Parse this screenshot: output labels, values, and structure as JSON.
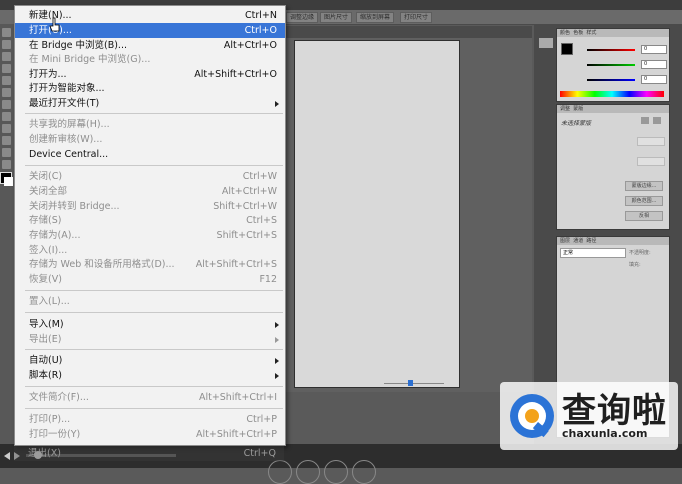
{
  "menu": {
    "items": [
      {
        "label": "新建(N)...",
        "shortcut": "Ctrl+N",
        "state": "normal"
      },
      {
        "label": "打开(O)...",
        "shortcut": "Ctrl+O",
        "state": "highlighted"
      },
      {
        "label": "在 Bridge 中浏览(B)...",
        "shortcut": "Alt+Ctrl+O",
        "state": "normal"
      },
      {
        "label": "在 Mini Bridge 中浏览(G)...",
        "shortcut": "",
        "state": "disabled"
      },
      {
        "label": "打开为...",
        "shortcut": "Alt+Shift+Ctrl+O",
        "state": "normal"
      },
      {
        "label": "打开为智能对象...",
        "shortcut": "",
        "state": "normal"
      },
      {
        "label": "最近打开文件(T)",
        "shortcut": "",
        "state": "submenu"
      },
      {
        "label": "共享我的屏幕(H)...",
        "shortcut": "",
        "state": "disabled"
      },
      {
        "label": "创建新审核(W)...",
        "shortcut": "",
        "state": "disabled"
      },
      {
        "label": "Device Central...",
        "shortcut": "",
        "state": "normal"
      },
      {
        "label": "关闭(C)",
        "shortcut": "Ctrl+W",
        "state": "disabled"
      },
      {
        "label": "关闭全部",
        "shortcut": "Alt+Ctrl+W",
        "state": "disabled"
      },
      {
        "label": "关闭并转到 Bridge...",
        "shortcut": "Shift+Ctrl+W",
        "state": "disabled"
      },
      {
        "label": "存储(S)",
        "shortcut": "Ctrl+S",
        "state": "disabled"
      },
      {
        "label": "存储为(A)...",
        "shortcut": "Shift+Ctrl+S",
        "state": "disabled"
      },
      {
        "label": "签入(I)...",
        "shortcut": "",
        "state": "disabled"
      },
      {
        "label": "存储为 Web 和设备所用格式(D)...",
        "shortcut": "Alt+Shift+Ctrl+S",
        "state": "disabled"
      },
      {
        "label": "恢复(V)",
        "shortcut": "F12",
        "state": "disabled"
      },
      {
        "label": "置入(L)...",
        "shortcut": "",
        "state": "disabled"
      },
      {
        "label": "导入(M)",
        "shortcut": "",
        "state": "submenu"
      },
      {
        "label": "导出(E)",
        "shortcut": "",
        "state": "submenu-disabled"
      },
      {
        "label": "自动(U)",
        "shortcut": "",
        "state": "submenu"
      },
      {
        "label": "脚本(R)",
        "shortcut": "",
        "state": "submenu"
      },
      {
        "label": "文件简介(F)...",
        "shortcut": "Alt+Shift+Ctrl+I",
        "state": "disabled"
      },
      {
        "label": "打印(P)...",
        "shortcut": "Ctrl+P",
        "state": "disabled"
      },
      {
        "label": "打印一份(Y)",
        "shortcut": "Alt+Shift+Ctrl+P",
        "state": "disabled"
      },
      {
        "label": "退出(X)",
        "shortcut": "Ctrl+Q",
        "state": "normal"
      }
    ]
  },
  "options_bar": {
    "btn1": "调整边缘",
    "btn2": "图片尺寸",
    "btn3": "缩放到屏幕",
    "btn4": "打印尺寸"
  },
  "color_panel": {
    "tab1": "颜色",
    "tab2": "色板",
    "tab3": "样式",
    "r": "0",
    "g": "0",
    "b": "0"
  },
  "adjust_panel": {
    "tab1": "调整",
    "tab2": "蒙版",
    "title": "未选择蒙版",
    "btn1": "蒙版边缘...",
    "btn2": "颜色范围...",
    "btn3": "反相"
  },
  "layers_panel": {
    "tab1": "图层",
    "tab2": "通道",
    "tab3": "路径",
    "mode": "正常",
    "opacity_label": "不透明度:",
    "fill_label": "填充:"
  },
  "watermark": {
    "text": "查询啦",
    "url": "chaxunla.com"
  },
  "colors": {
    "highlight": "#3875d7",
    "menu_bg": "#f2f2f2",
    "workspace": "#5a5a5a"
  }
}
